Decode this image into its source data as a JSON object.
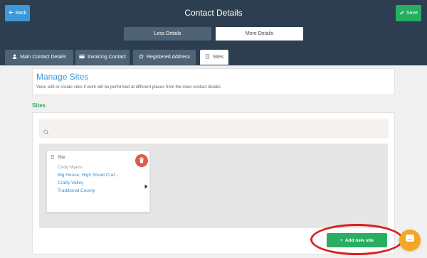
{
  "header": {
    "title": "Contact Details",
    "back_label": "Back",
    "save_label": "Save"
  },
  "detail_toggle": {
    "less_label": "Less Details",
    "more_label": "More Details"
  },
  "tabs": [
    {
      "label": "Main Contact Details",
      "icon": "user-icon"
    },
    {
      "label": "Invoicing Contact",
      "icon": "card-icon"
    },
    {
      "label": "Registered Address",
      "icon": "star-icon"
    },
    {
      "label": "Sites",
      "icon": "building-icon"
    }
  ],
  "manage": {
    "title": "Manage Sites",
    "description": "View, edit or create sites if work will be performed at different places from the main contact details."
  },
  "sites_heading": "Sites",
  "search": {
    "placeholder": ""
  },
  "site_card": {
    "label": "Site",
    "contact_name": "Cody Myers",
    "address_line1": "Big House, High Street Craf...",
    "address_line2": "Crafty Valley",
    "address_line3": "Traditional County"
  },
  "add_site_label": "Add new site",
  "colors": {
    "header_bg": "#2d3e50",
    "accent_blue": "#3a9ad9",
    "accent_green": "#27ae60",
    "delete_red": "#e05a4a",
    "highlight_red": "#d8201f",
    "chat_orange": "#f5a623"
  }
}
